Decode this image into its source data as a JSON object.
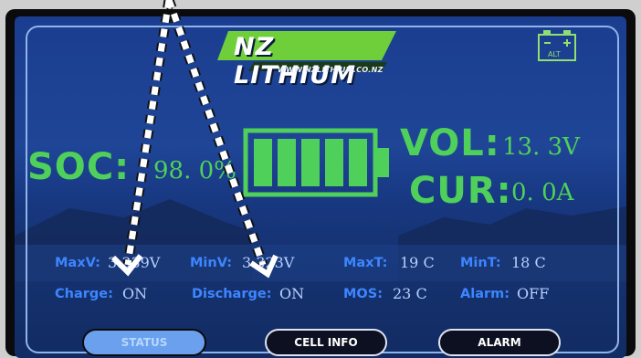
{
  "brand": {
    "name": "NZ LITHIUM",
    "url": "WWW.NZLITHIUM.CO.NZ"
  },
  "alt_icon": {
    "icon": "car-battery-icon",
    "label": "ALT"
  },
  "soc": {
    "label": "SOC:",
    "value": "98. 0%",
    "fill_fraction": 0.98
  },
  "vol": {
    "label": "VOL:",
    "value": "13. 3V"
  },
  "cur": {
    "label": "CUR:",
    "value": "0. 0A"
  },
  "stats": {
    "maxv_label": "MaxV:",
    "maxv_value": "3.339V",
    "minv_label": "MinV:",
    "minv_value": "3.323V",
    "maxt_label": "MaxT:",
    "maxt_value": "19 C",
    "mint_label": "MinT:",
    "mint_value": "18 C",
    "charge_label": "Charge:",
    "charge_value": "ON",
    "discharge_label": "Discharge:",
    "discharge_value": "ON",
    "mos_label": "MOS:",
    "mos_value": "23 C",
    "alarm_label": "Alarm:",
    "alarm_value": "OFF"
  },
  "tabs": [
    {
      "label": "STATUS",
      "active": true
    },
    {
      "label": "CELL INFO",
      "active": false
    },
    {
      "label": "ALARM",
      "active": false
    }
  ],
  "colors": {
    "accent_green": "#4fd05a",
    "label_blue": "#3d86ff",
    "frame": "#8fb3ea",
    "arrow": "#ffffff"
  }
}
